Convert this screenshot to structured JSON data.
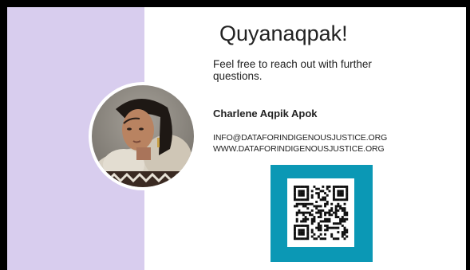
{
  "slide": {
    "title": "Quyanaqpak!",
    "message": "Feel free to reach out with further questions.",
    "name": "Charlene Aqpik Apok",
    "email": "INFO@DATAFORINDIGENOUSJUSTICE.ORG",
    "website": "WWW.DATAFORINDIGENOUSJUSTICE.ORG"
  },
  "colors": {
    "side_panel": "#d8cdee",
    "qr_background": "#0b98b5",
    "text": "#222222",
    "frame": "#000000"
  }
}
